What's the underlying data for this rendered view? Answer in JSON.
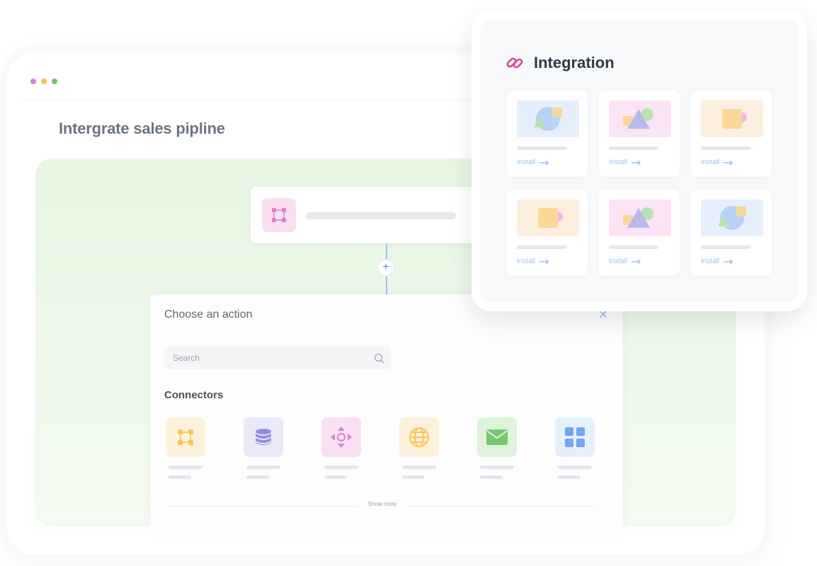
{
  "window": {
    "title": "Intergrate sales pipline",
    "dots": [
      "#e27ccf",
      "#f2c44d",
      "#6cc26b"
    ]
  },
  "action_panel": {
    "title": "Choose an action",
    "search": {
      "placeholder": "Search",
      "value": ""
    },
    "connectors_heading": "Connectors",
    "connectors": [
      {
        "icon": "nodes-icon",
        "bg": "#fdf0dd",
        "color": "#f7c650"
      },
      {
        "icon": "database-icon",
        "bg": "#e9e9f9",
        "color": "#8f8fe0"
      },
      {
        "icon": "move-icon",
        "bg": "#f8dff2",
        "color": "#d982cb"
      },
      {
        "icon": "globe-icon",
        "bg": "#fdf0dd",
        "color": "#f7c650"
      },
      {
        "icon": "mail-icon",
        "bg": "#dff2dc",
        "color": "#76c86f"
      },
      {
        "icon": "apps-grid-icon",
        "bg": "#e6f0fd",
        "color": "#72a6ef"
      }
    ],
    "show_more": "Show more"
  },
  "integration": {
    "title": "Integration",
    "icon": "link-icon",
    "cards": [
      {
        "install_label": "Install",
        "thumb": "circle-square",
        "thumb_bg": "#e6f0fd"
      },
      {
        "install_label": "Install",
        "thumb": "triangle",
        "thumb_bg": "#fbe4f6"
      },
      {
        "install_label": "Install",
        "thumb": "square-half",
        "thumb_bg": "#fdefdf"
      },
      {
        "install_label": "Install",
        "thumb": "square-half",
        "thumb_bg": "#fdefdf"
      },
      {
        "install_label": "Install",
        "thumb": "triangle",
        "thumb_bg": "#fbe4f6"
      },
      {
        "install_label": "Install",
        "thumb": "circle-square",
        "thumb_bg": "#e6f0fd"
      }
    ]
  },
  "colors": {
    "accent": "#4b8fe8",
    "link": "#d6489f",
    "canvas": "#e7f6e3"
  }
}
